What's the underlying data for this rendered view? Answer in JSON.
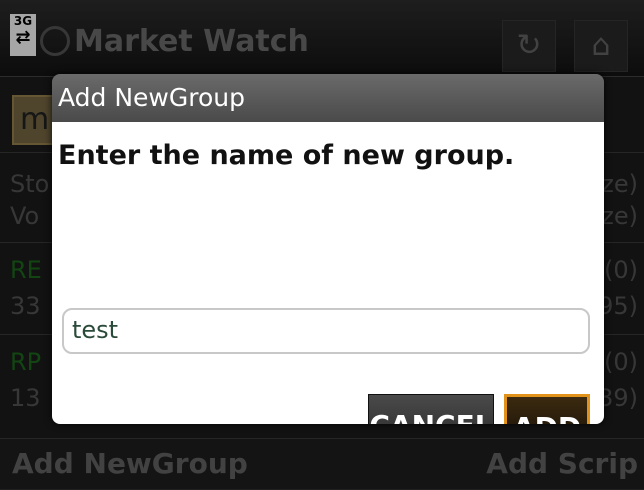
{
  "status_bar": {
    "network": "3G"
  },
  "header": {
    "title": "Market Watch",
    "refresh_icon": "refresh-icon",
    "home_icon": "home-icon"
  },
  "search": {
    "value": "m"
  },
  "background_rows": [
    {
      "left": "Sto",
      "right": "ze)"
    },
    {
      "left": "Vo",
      "right": "ze)"
    },
    {
      "left": "RE",
      "right": "(0)"
    },
    {
      "left": "33",
      "right": "95)"
    },
    {
      "left": "RP",
      "right": "(0)"
    },
    {
      "left": "13",
      "right": "39)"
    }
  ],
  "footer": {
    "add_group_label": "Add NewGroup",
    "add_scrip_label": "Add Scrip"
  },
  "dialog": {
    "title": "Add NewGroup",
    "message": "Enter the name of new group.",
    "input_value": "test",
    "cancel_label": "CANCEL",
    "add_label": "ADD"
  },
  "colors": {
    "accent": "#e0921a",
    "dialog_title_bg": "#555555",
    "body_bg": "#ffffff"
  }
}
